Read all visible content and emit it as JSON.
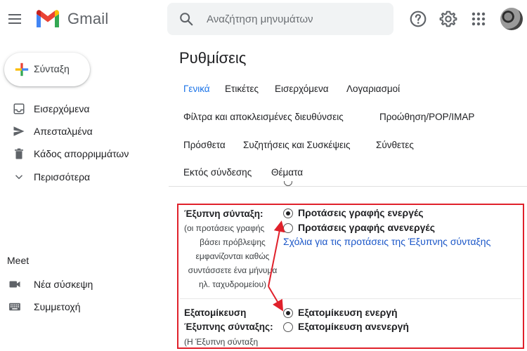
{
  "app": {
    "name": "Gmail"
  },
  "search": {
    "placeholder": "Αναζήτηση μηνυμάτων"
  },
  "compose": {
    "label": "Σύνταξη"
  },
  "sidebar": {
    "items": [
      {
        "label": "Εισερχόμενα",
        "icon": "inbox-icon"
      },
      {
        "label": "Απεσταλμένα",
        "icon": "send-icon"
      },
      {
        "label": "Κάδος απορριμμάτων",
        "icon": "trash-icon"
      },
      {
        "label": "Περισσότερα",
        "icon": "chevron-down-icon"
      }
    ],
    "meet": {
      "title": "Meet",
      "items": [
        {
          "label": "Νέα σύσκεψη",
          "icon": "video-camera-icon"
        },
        {
          "label": "Συμμετοχή",
          "icon": "keyboard-icon"
        }
      ]
    }
  },
  "settings": {
    "title": "Ρυθμίσεις",
    "tabs": [
      {
        "label": "Γενικά"
      },
      {
        "label": "Ετικέτες"
      },
      {
        "label": "Εισερχόμενα"
      },
      {
        "label": "Λογαριασμοί"
      },
      {
        "label": "Φίλτρα και αποκλεισμένες διευθύνσεις"
      },
      {
        "label": "Προώθηση/POP/IMAP"
      },
      {
        "label": "Πρόσθετα"
      },
      {
        "label": "Συζητήσεις και Συσκέψεις"
      },
      {
        "label": "Σύνθετες"
      },
      {
        "label": "Εκτός σύνδεσης"
      },
      {
        "label": "Θέματα"
      }
    ],
    "active_tab": "Γενικά",
    "smart_compose": {
      "label": "Έξυπνη σύνταξη:",
      "desc_lines": [
        "(οι προτάσεις γραφής",
        "βάσει πρόβλεψης",
        "εμφανίζονται καθώς",
        "συντάσσετε ένα μήνυμα",
        "ηλ. ταχυδρομείου)"
      ],
      "options": [
        {
          "label": "Προτάσεις γραφής ενεργές",
          "checked": true
        },
        {
          "label": "Προτάσεις γραφής ανενεργές",
          "checked": false
        }
      ],
      "feedback_link": "Σχόλια για τις προτάσεις της Έξυπνης σύνταξης"
    },
    "personalization": {
      "label_lines": [
        "Εξατομίκευση",
        "Έξυπνης σύνταξης:"
      ],
      "desc": "(Η Έξυπνη σύνταξη",
      "options": [
        {
          "label": "Εξατομίκευση ενεργή",
          "checked": true
        },
        {
          "label": "Εξατομίκευση ανενεργή",
          "checked": false
        }
      ]
    }
  },
  "colors": {
    "accent": "#1a73e8",
    "highlight": "#e0212b",
    "link": "#1a56c8"
  }
}
